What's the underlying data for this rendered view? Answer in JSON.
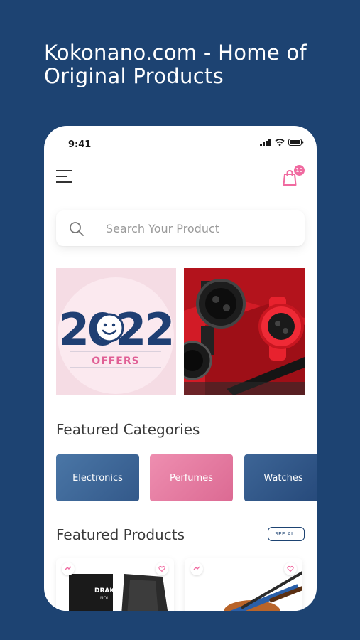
{
  "headline": "Kokonano.com - Home of Original Products",
  "status": {
    "time": "9:41"
  },
  "cart": {
    "count": "10"
  },
  "search": {
    "placeholder": "Search Your Product"
  },
  "banners": [
    {
      "year": "2022",
      "label": "OFFERS"
    },
    {
      "subject": "watches"
    }
  ],
  "featured_categories": {
    "title": "Featured Categories",
    "items": [
      {
        "label": "Electronics"
      },
      {
        "label": "Perfumes"
      },
      {
        "label": "Watches"
      }
    ]
  },
  "featured_products": {
    "title": "Featured Products",
    "see_all": "SEE ALL",
    "items": [
      {
        "brand": "DRAKK",
        "sub": "NOI"
      },
      {
        "subject": "violin"
      }
    ]
  },
  "colors": {
    "background": "#1d4372",
    "accent_pink": "#f06aa0",
    "electronics": "#3f6a99",
    "perfumes": "#e77da1",
    "watches": "#2f5585"
  }
}
